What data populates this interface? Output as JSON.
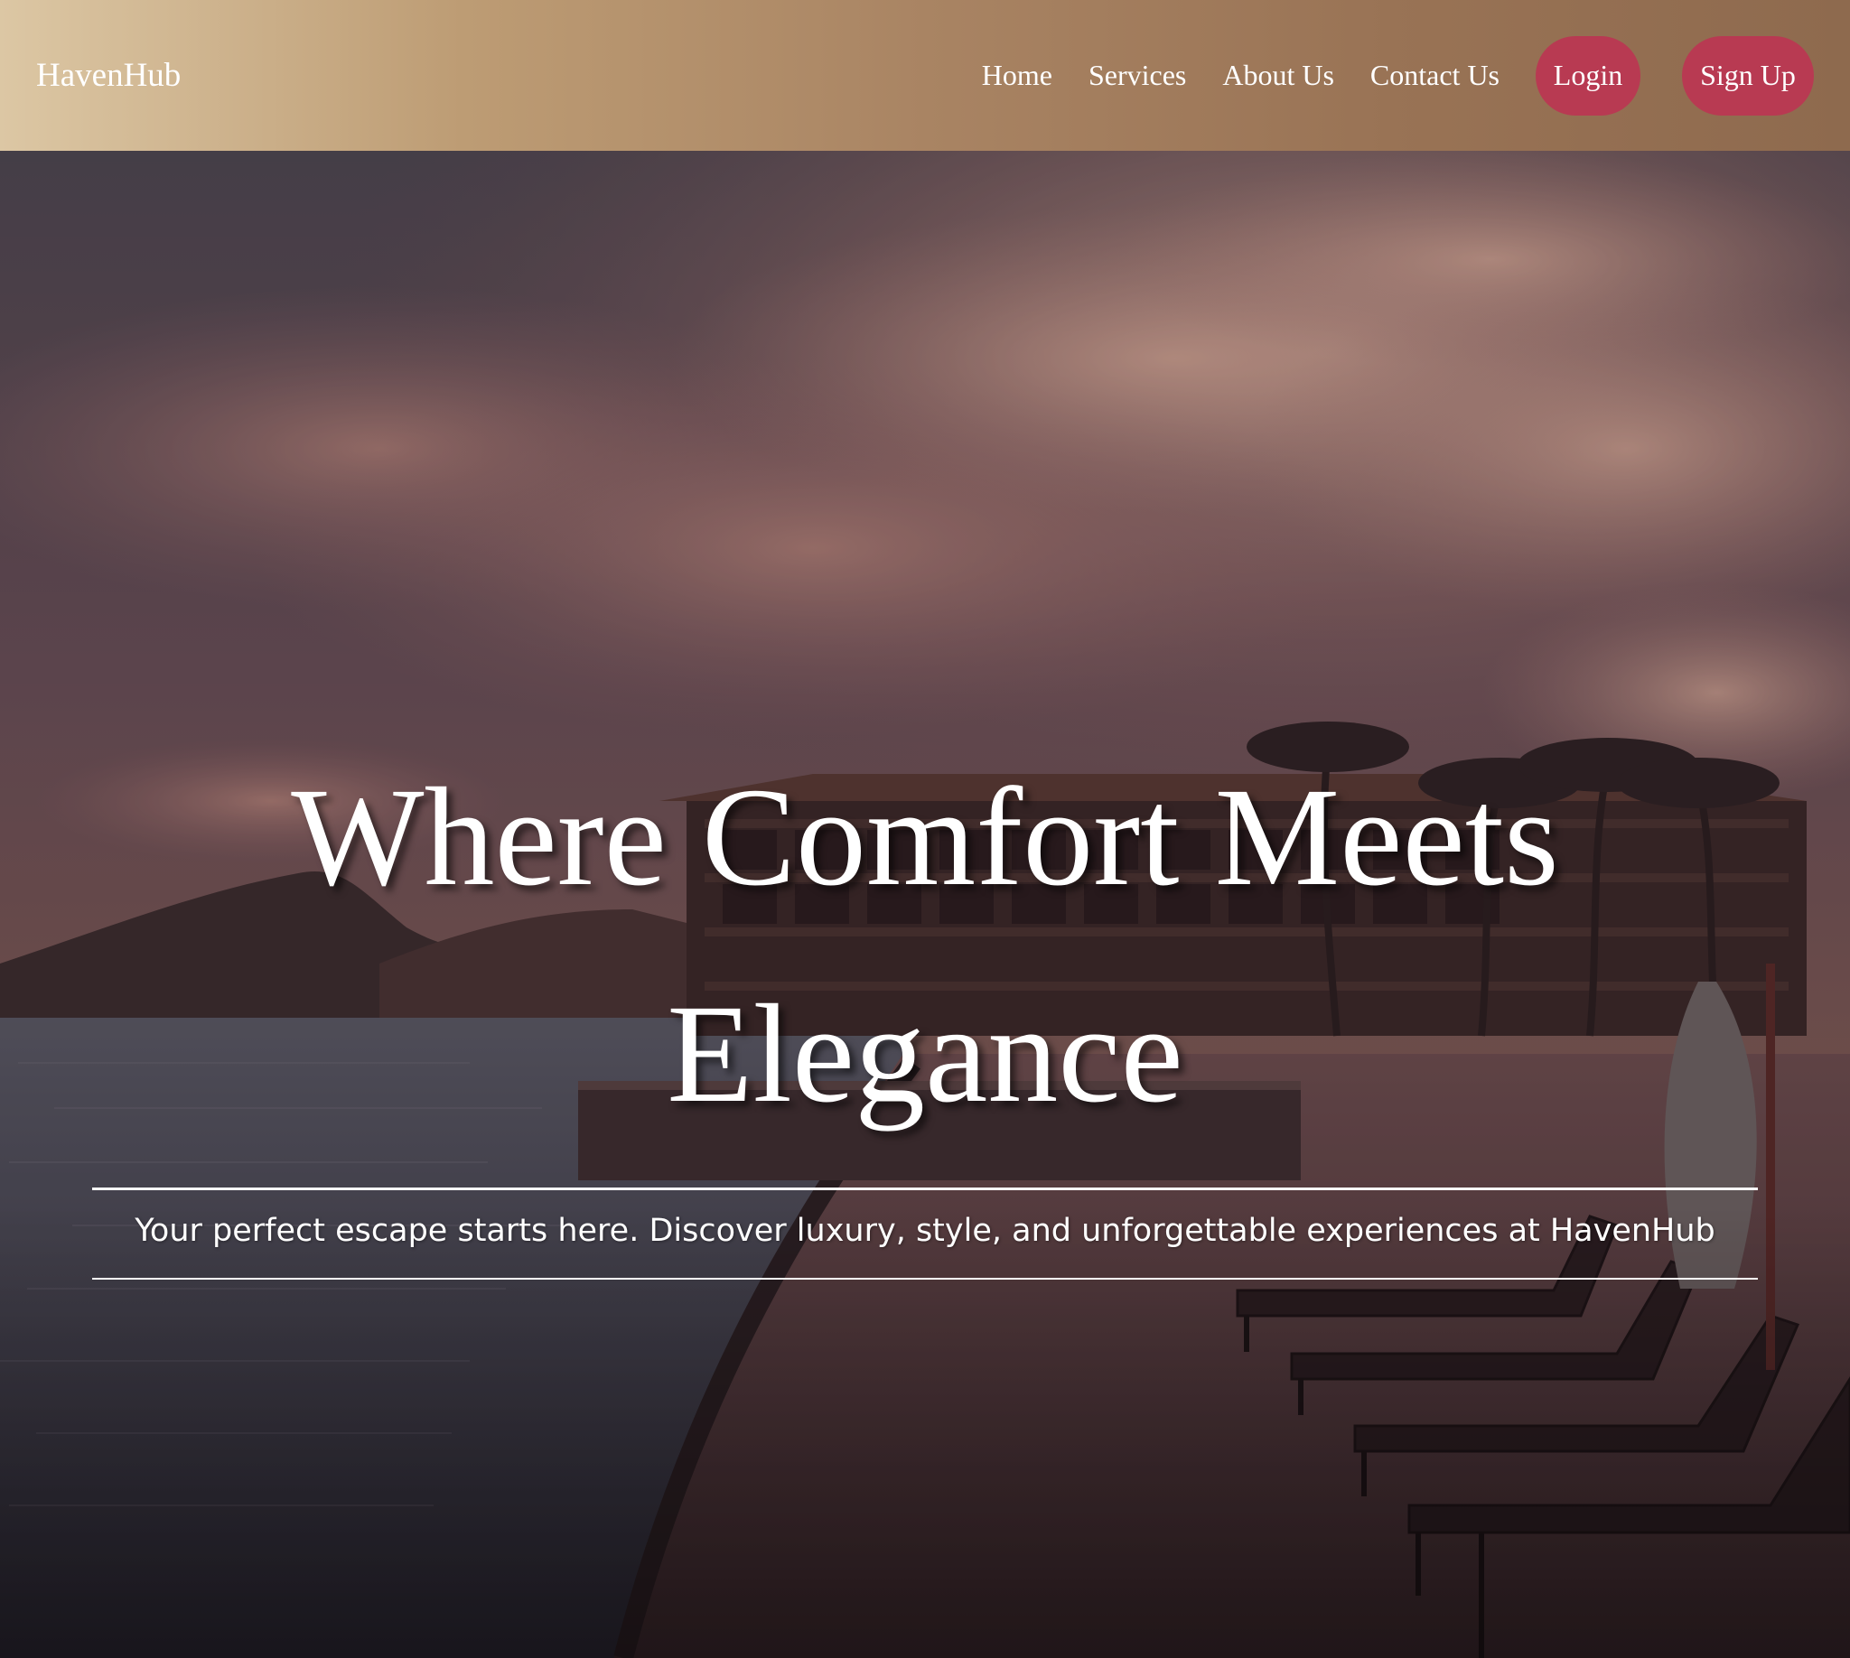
{
  "nav": {
    "brand": "HavenHub",
    "links": [
      "Home",
      "Services",
      "About Us",
      "Contact Us"
    ],
    "login_label": "Login",
    "signup_label": "Sign Up"
  },
  "hero": {
    "title": "Where Comfort Meets Elegance",
    "subtitle": "Your perfect escape starts here. Discover luxury, style, and unforgettable experiences at HavenHub"
  },
  "colors": {
    "nav_gradient_start": "#dcc7a4",
    "nav_gradient_end": "#8e6a4e",
    "button_accent": "#b83a52",
    "text": "#ffffff"
  }
}
